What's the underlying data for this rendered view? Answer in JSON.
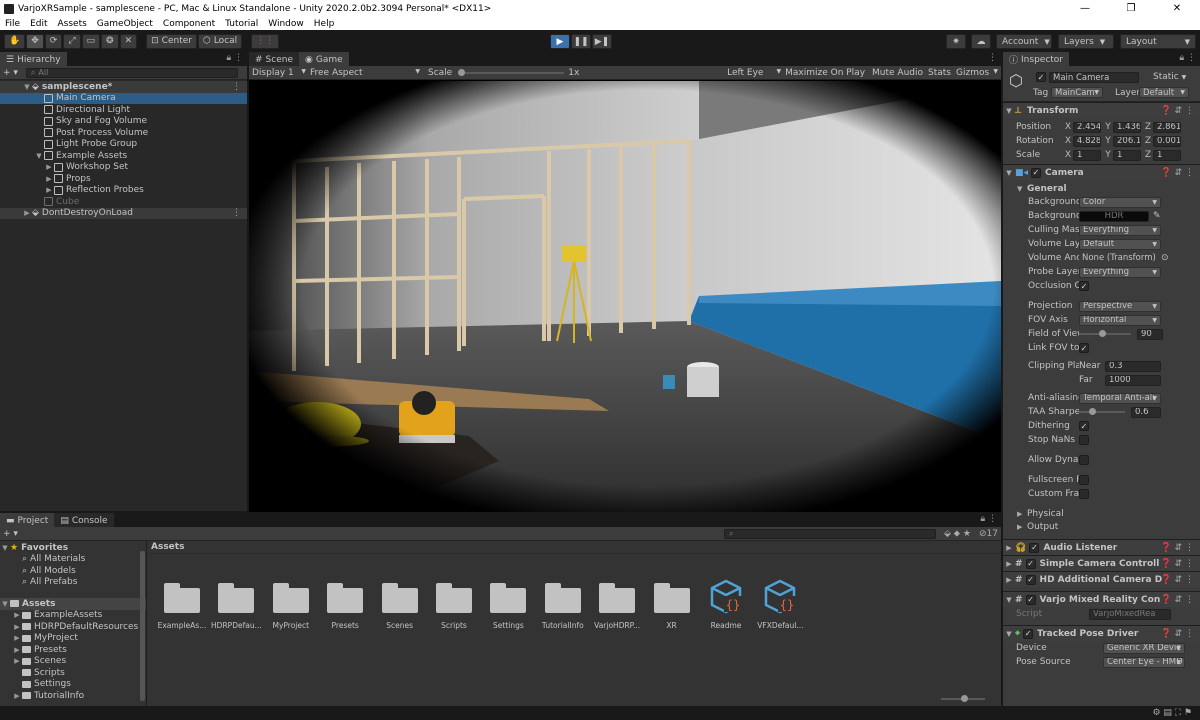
{
  "window": {
    "title": "VarjoXRSample - samplescene - PC, Mac & Linux Standalone - Unity 2020.2.0b2.3094 Personal* <DX11>"
  },
  "menu": [
    "File",
    "Edit",
    "Assets",
    "GameObject",
    "Component",
    "Tutorial",
    "Window",
    "Help"
  ],
  "toolbar": {
    "center_label": "Center",
    "local_label": "Local",
    "account_label": "Account",
    "layers_label": "Layers",
    "layout_label": "Layout"
  },
  "hierarchy": {
    "tab_label": "Hierarchy",
    "search_placeholder": "All",
    "scene_name": "samplescene*",
    "items": [
      {
        "label": "Main Camera",
        "depth": 2,
        "arrow": ""
      },
      {
        "label": "Directional Light",
        "depth": 2,
        "arrow": ""
      },
      {
        "label": "Sky and Fog Volume",
        "depth": 2,
        "arrow": ""
      },
      {
        "label": "Post Process Volume",
        "depth": 2,
        "arrow": ""
      },
      {
        "label": "Light Probe Group",
        "depth": 2,
        "arrow": ""
      },
      {
        "label": "Example Assets",
        "depth": 2,
        "arrow": "▼"
      },
      {
        "label": "Workshop Set",
        "depth": 3,
        "arrow": "▶"
      },
      {
        "label": "Props",
        "depth": 3,
        "arrow": "▶"
      },
      {
        "label": "Reflection Probes",
        "depth": 3,
        "arrow": "▶"
      },
      {
        "label": "Cube",
        "depth": 2,
        "arrow": ""
      }
    ],
    "dontdestroy_label": "DontDestroyOnLoad"
  },
  "scene_tabs": {
    "scene_label": "Scene",
    "game_label": "Game"
  },
  "game_bar": {
    "display_label": "Display 1",
    "aspect_label": "Free Aspect",
    "scale_label": "Scale",
    "scale_value": "1x",
    "eye_label": "Left Eye",
    "maximize_label": "Maximize On Play",
    "mute_label": "Mute Audio",
    "stats_label": "Stats",
    "gizmos_label": "Gizmos"
  },
  "inspector": {
    "tab_label": "Inspector",
    "object_name": "Main Camera",
    "static_label": "Static",
    "tag_label": "Tag",
    "tag_value": "MainCam",
    "layer_label": "Layer",
    "layer_value": "Default",
    "transform": {
      "header": "Transform",
      "position_label": "Position",
      "position": [
        "2.454",
        "1.436",
        "2.861"
      ],
      "rotation_label": "Rotation",
      "rotation": [
        "4.828",
        "206.17",
        "0.001"
      ],
      "scale_label": "Scale",
      "scale": [
        "1",
        "1",
        "1"
      ]
    },
    "camera": {
      "header": "Camera",
      "general_label": "General",
      "background_type_label": "Background Type",
      "background_type": "Color",
      "background_color_label": "Background Color",
      "hdr_label": "HDR",
      "culling_mask_label": "Culling Mask",
      "culling_mask": "Everything",
      "volume_layer_label": "Volume Layer Mas",
      "volume_layer": "Default",
      "volume_anchor_label": "Volume Anchor Ov",
      "volume_anchor": "None (Transform)",
      "probe_layer_label": "Probe Layer Mask",
      "probe_layer": "Everything",
      "occlusion_label": "Occlusion Culling",
      "projection_label": "Projection",
      "projection": "Perspective",
      "fov_axis_label": "FOV Axis",
      "fov_axis": "Horizontal",
      "fov_label": "Field of View",
      "fov": "90",
      "link_fov_label": "Link FOV to Physic",
      "clipping_label": "Clipping Planes",
      "near_label": "Near",
      "near": "0.3",
      "far_label": "Far",
      "far": "1000",
      "aa_label": "Anti-aliasing",
      "aa": "Temporal Anti-ali",
      "taa_label": "TAA Sharpen Stren",
      "taa": "0.6",
      "dithering_label": "Dithering",
      "stopnans_label": "Stop NaNs",
      "dynres_label": "Allow Dynamic Res",
      "passthrough_label": "Fullscreen Passthr",
      "customframe_label": "Custom Frame Set",
      "physical_label": "Physical",
      "output_label": "Output"
    },
    "components": [
      "Audio Listener",
      "Simple Camera Controll",
      "HD Additional Camera D"
    ],
    "varjo": {
      "header": "Varjo Mixed Reality Con",
      "script_label": "Script",
      "script_value": "VarjoMixedRea"
    },
    "tracked": {
      "header": "Tracked Pose Driver",
      "device_label": "Device",
      "device": "Generic XR Devic",
      "pose_label": "Pose Source",
      "pose": "Center Eye - HMD"
    }
  },
  "project": {
    "tab_project": "Project",
    "tab_console": "Console",
    "hidden_count": "17",
    "favorites_label": "Favorites",
    "favorites": [
      "All Materials",
      "All Models",
      "All Prefabs"
    ],
    "assets_label": "Assets",
    "asset_folders_tree": [
      "ExampleAssets",
      "HDRPDefaultResources",
      "MyProject",
      "Presets",
      "Scenes",
      "Scripts",
      "Settings",
      "TutorialInfo"
    ],
    "breadcrumb": "Assets",
    "grid": [
      {
        "label": "ExampleAs...",
        "kind": "folder"
      },
      {
        "label": "HDRPDefau...",
        "kind": "folder"
      },
      {
        "label": "MyProject",
        "kind": "folder"
      },
      {
        "label": "Presets",
        "kind": "folder"
      },
      {
        "label": "Scenes",
        "kind": "folder"
      },
      {
        "label": "Scripts",
        "kind": "folder"
      },
      {
        "label": "Settings",
        "kind": "folder"
      },
      {
        "label": "TutorialInfo",
        "kind": "folder"
      },
      {
        "label": "VarjoHDRP...",
        "kind": "folder"
      },
      {
        "label": "XR",
        "kind": "folder"
      },
      {
        "label": "Readme",
        "kind": "asset"
      },
      {
        "label": "VFXDefaul...",
        "kind": "asset"
      }
    ]
  },
  "colors": {
    "accent": "#3a72b0",
    "selection": "#2c5d87",
    "panel": "#282828",
    "header": "#3c3c3c",
    "wall_blue": "#1f6fa8"
  }
}
